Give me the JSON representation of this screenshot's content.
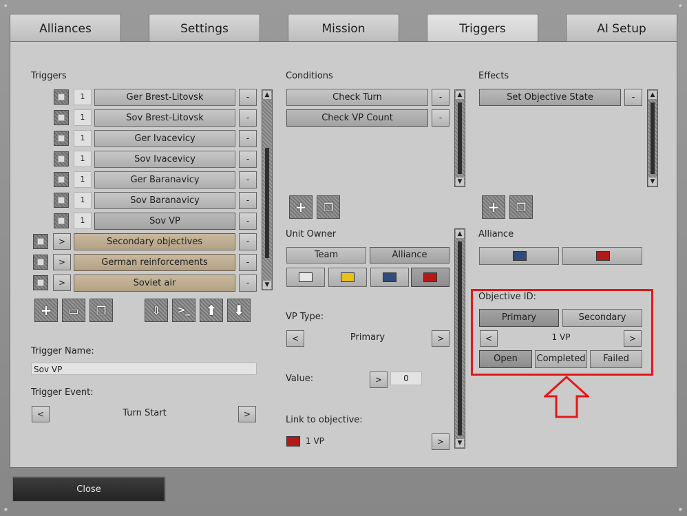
{
  "tabs": [
    "Alliances",
    "Settings",
    "Mission",
    "Triggers",
    "AI Setup"
  ],
  "triggers": {
    "header": "Triggers",
    "items": [
      {
        "num": "1",
        "label": "Ger Brest-Litovsk",
        "kind": "trigger"
      },
      {
        "num": "1",
        "label": "Sov Brest-Litovsk",
        "kind": "trigger"
      },
      {
        "num": "1",
        "label": "Ger Ivacevicy",
        "kind": "trigger"
      },
      {
        "num": "1",
        "label": "Sov Ivacevicy",
        "kind": "trigger"
      },
      {
        "num": "1",
        "label": "Ger Baranavicy",
        "kind": "trigger"
      },
      {
        "num": "1",
        "label": "Sov Baranavicy",
        "kind": "trigger"
      },
      {
        "num": "1",
        "label": "Sov VP",
        "kind": "trigger"
      },
      {
        "num": ">",
        "label": "Secondary objectives",
        "kind": "group"
      },
      {
        "num": ">",
        "label": "German reinforcements",
        "kind": "group"
      },
      {
        "num": ">",
        "label": "Soviet air",
        "kind": "group"
      }
    ],
    "remove_label": "-",
    "trigger_name_label": "Trigger Name:",
    "trigger_name_value": "Sov VP",
    "trigger_event_label": "Trigger Event:",
    "trigger_event_value": "Turn Start",
    "prev": "<",
    "next": ">"
  },
  "conditions": {
    "header": "Conditions",
    "items": [
      "Check Turn",
      "Check VP Count"
    ],
    "remove_label": "-",
    "unit_owner_label": "Unit Owner",
    "team_label": "Team",
    "alliance_label": "Alliance",
    "owner_colors": [
      "#e6e6e6",
      "#e8c21b",
      "#2f4d7a",
      "#b21a1a"
    ],
    "vp_type_label": "VP Type:",
    "vp_type_value": "Primary",
    "value_label": "Value:",
    "value_value": "0",
    "link_label": "Link to objective:",
    "link_value": "1 VP",
    "link_color": "#b21a1a",
    "prev": "<",
    "next": ">"
  },
  "effects": {
    "header": "Effects",
    "items": [
      "Set Objective State"
    ],
    "remove_label": "-",
    "alliance_label": "Alliance",
    "alliance_colors": [
      "#2f4d7a",
      "#b21a1a"
    ],
    "objective_id_label": "Objective ID:",
    "primary_label": "Primary",
    "secondary_label": "Secondary",
    "objective_value": "1 VP",
    "open_label": "Open",
    "completed_label": "Completed",
    "failed_label": "Failed",
    "prev": "<",
    "next": ">"
  },
  "close_label": "Close",
  "highlight_color": "#e5161a"
}
